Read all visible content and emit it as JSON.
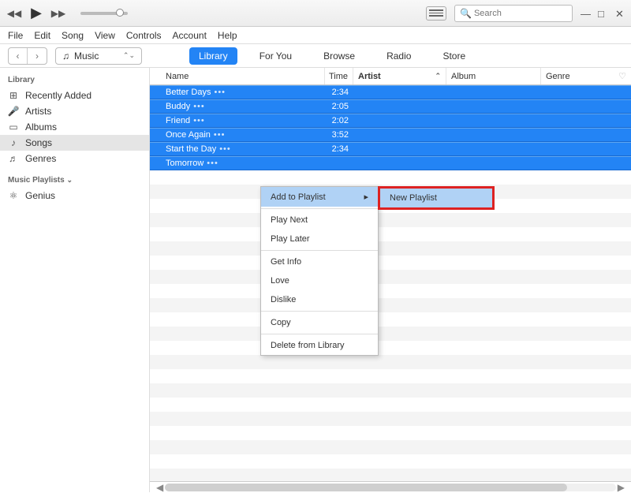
{
  "search": {
    "placeholder": "Search",
    "prefix": "Q"
  },
  "menubar": [
    "File",
    "Edit",
    "Song",
    "View",
    "Controls",
    "Account",
    "Help"
  ],
  "media_selector": "Music",
  "tabs": [
    {
      "label": "Library",
      "active": true
    },
    {
      "label": "For You",
      "active": false
    },
    {
      "label": "Browse",
      "active": false
    },
    {
      "label": "Radio",
      "active": false
    },
    {
      "label": "Store",
      "active": false
    }
  ],
  "sidebar": {
    "library_header": "Library",
    "library": [
      {
        "label": "Recently Added",
        "icon": "⊞"
      },
      {
        "label": "Artists",
        "icon": "🎤"
      },
      {
        "label": "Albums",
        "icon": "▭"
      },
      {
        "label": "Songs",
        "icon": "♪",
        "active": true
      },
      {
        "label": "Genres",
        "icon": "♬"
      }
    ],
    "playlists_header": "Music Playlists",
    "playlists": [
      {
        "label": "Genius",
        "icon": "⚛"
      }
    ]
  },
  "columns": {
    "name": "Name",
    "time": "Time",
    "artist": "Artist",
    "album": "Album",
    "genre": "Genre",
    "sort_indicator": "⌃"
  },
  "songs": [
    {
      "name": "Better Days",
      "time": "2:34",
      "selected": true
    },
    {
      "name": "Buddy",
      "time": "2:05",
      "selected": true
    },
    {
      "name": "Friend",
      "time": "2:02",
      "selected": true
    },
    {
      "name": "Once Again",
      "time": "3:52",
      "selected": true
    },
    {
      "name": "Start the Day",
      "time": "2:34",
      "selected": true
    },
    {
      "name": "Tomorrow",
      "time": "",
      "selected": true
    }
  ],
  "context_menu": {
    "highlighted": "Add to Playlist",
    "items": [
      "Play Next",
      "Play Later"
    ],
    "items2": [
      "Get Info",
      "Love",
      "Dislike"
    ],
    "items3": [
      "Copy"
    ],
    "items4": [
      "Delete from Library"
    ]
  },
  "submenu": {
    "item": "New Playlist"
  }
}
